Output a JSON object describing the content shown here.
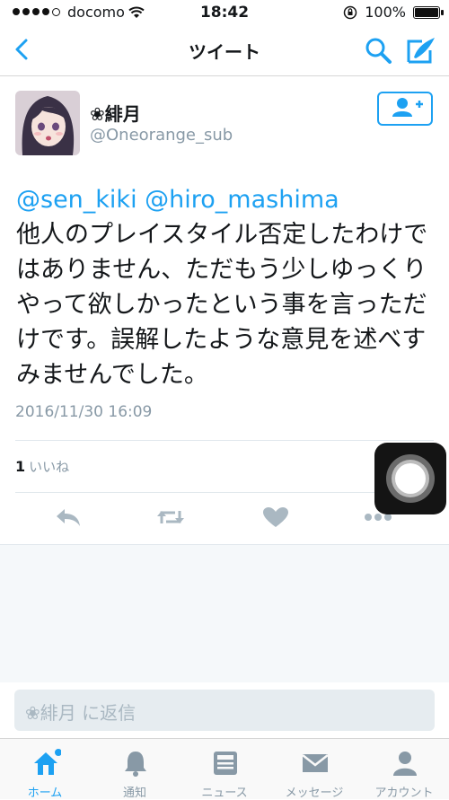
{
  "status_bar": {
    "carrier": "docomo",
    "time": "18:42",
    "battery": "100%",
    "battery_level": 1.0
  },
  "nav": {
    "title": "ツイート"
  },
  "tweet": {
    "display_name": "❀緋月",
    "handle": "@Oneorange_sub",
    "mentions": [
      "@sen_kiki",
      "@hiro_mashima"
    ],
    "body": "他人のプレイスタイル否定したわけではありません、ただもう少しゆっくりやって欲しかったという事を言っただけです。誤解したような意見を述べすみませんでした。",
    "timestamp": "2016/11/30 16:09",
    "like_count": "1",
    "like_label": "いいね"
  },
  "reply_box": {
    "placeholder": "❀緋月 に返信"
  },
  "tabs": [
    {
      "label": "ホーム",
      "icon": "home-icon",
      "active": true
    },
    {
      "label": "通知",
      "icon": "bell-icon"
    },
    {
      "label": "ニュース",
      "icon": "news-icon"
    },
    {
      "label": "メッセージ",
      "icon": "envelope-icon"
    },
    {
      "label": "アカウント",
      "icon": "person-icon"
    }
  ],
  "colors": {
    "accent": "#1da1f2",
    "secondary_text": "#8899a6"
  }
}
